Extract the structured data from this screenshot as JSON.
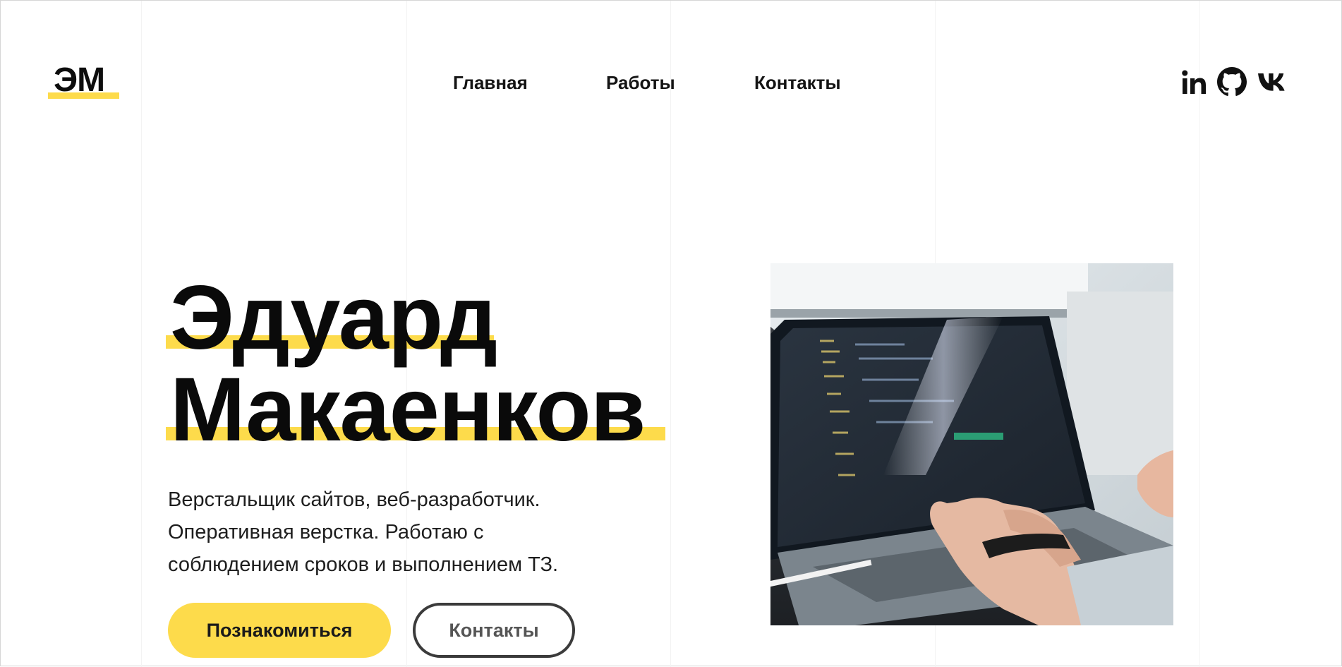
{
  "header": {
    "logo_text": "ЭМ",
    "nav": [
      {
        "label": "Главная"
      },
      {
        "label": "Работы"
      },
      {
        "label": "Контакты"
      }
    ],
    "social_icons": [
      "linkedin-icon",
      "github-icon",
      "vk-icon"
    ]
  },
  "hero": {
    "first_name": "Эдуард",
    "last_name": "Макаенков",
    "description": "Верстальщик сайтов, веб-разработчик. Оперативная верстка. Работаю с соблюдением сроков и выполнением ТЗ.",
    "primary_button": "Познакомиться",
    "secondary_button": "Контакты",
    "image": "photo of hands typing on a laptop with code on screen"
  },
  "colors": {
    "accent": "#fddb4b",
    "text": "#111111",
    "background": "#ffffff",
    "secondary_border": "#3b3b3b"
  }
}
